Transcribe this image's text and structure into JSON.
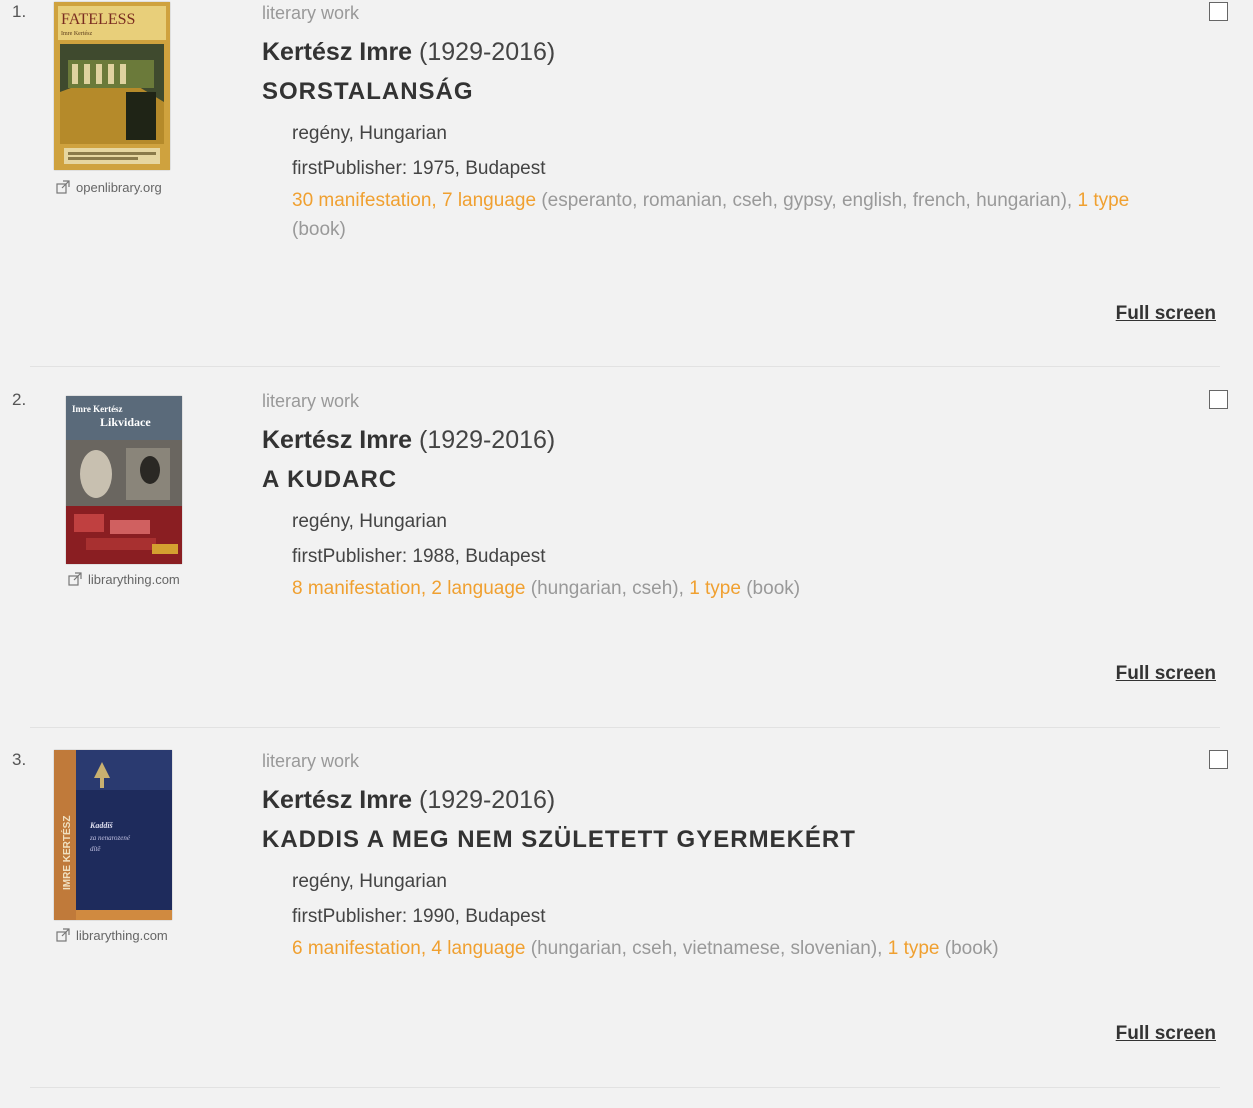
{
  "records": [
    {
      "number": "1.",
      "cover_source": "openlibrary.org",
      "cover_text": {
        "title": "FATELESS",
        "subtitle": "Imre Kertész"
      },
      "kind": "literary work",
      "author_name": "Kertész Imre",
      "author_dates": "(1929-2016)",
      "title": "SORSTALANSÁG",
      "genre_lang": "regény, Hungarian",
      "first_publisher": "firstPublisher: 1975, Budapest",
      "manifestations": "30 manifestation",
      "languages": "7 language",
      "language_list": "(esperanto, romanian, cseh, gypsy, english, french, hungarian)",
      "types": "1 type",
      "type_list": "(book)",
      "full_screen": "Full screen"
    },
    {
      "number": "2.",
      "cover_source": "librarything.com",
      "cover_text": {
        "title": "Imre Kertész",
        "subtitle": "Likvidace"
      },
      "kind": "literary work",
      "author_name": "Kertész Imre",
      "author_dates": "(1929-2016)",
      "title": "A KUDARC",
      "genre_lang": "regény, Hungarian",
      "first_publisher": "firstPublisher: 1988, Budapest",
      "manifestations": "8 manifestation",
      "languages": "2 language",
      "language_list": "(hungarian, cseh)",
      "types": "1 type",
      "type_list": "(book)",
      "full_screen": "Full screen"
    },
    {
      "number": "3.",
      "cover_source": "librarything.com",
      "cover_text": {
        "title": "IMRE KERTÉSZ",
        "subtitle": "Kaddiš za nenarozené dítě"
      },
      "kind": "literary work",
      "author_name": "Kertész Imre",
      "author_dates": "(1929-2016)",
      "title": "KADDIS A MEG NEM SZÜLETETT GYERMEKÉRT",
      "genre_lang": "regény, Hungarian",
      "first_publisher": "firstPublisher: 1990, Budapest",
      "manifestations": "6 manifestation",
      "languages": "4 language",
      "language_list": "(hungarian, cseh, vietnamese, slovenian)",
      "types": "1 type",
      "type_list": "(book)",
      "full_screen": "Full screen"
    }
  ],
  "colors": {
    "link_orange": "#f0a030",
    "muted_gray": "#999999",
    "background": "#f2f2f2"
  },
  "icons": {
    "external_link": "external-link-icon",
    "checkbox": "select-checkbox"
  }
}
